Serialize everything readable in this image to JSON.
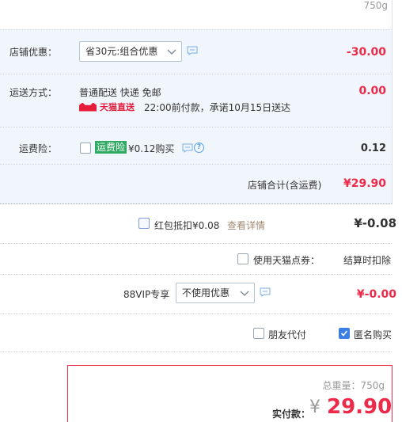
{
  "top": {
    "weight": "750g"
  },
  "shop": {
    "discount": {
      "label": "店铺优惠：",
      "select_value": "省30元:组合优惠",
      "amount": "-30.00"
    },
    "shipping": {
      "label": "运送方式：",
      "methods": "普通配送 快递 免邮",
      "badge": "天猫直送",
      "promise": "22:00前付款，承诺10月15日送达",
      "amount": "0.00"
    },
    "insurance": {
      "label": "运费险：",
      "tag": "运费险",
      "price_text": "¥0.12购买",
      "amount": "0.12"
    },
    "total": {
      "label": "店铺合计(含运费)",
      "amount": "¥29.90"
    }
  },
  "redpacket": {
    "label": "红包抵扣¥0.08",
    "link": "查看详情",
    "amount": "¥-0.08"
  },
  "points": {
    "label": "使用天猫点券：",
    "note": "结算时扣除"
  },
  "vip": {
    "label": "88VIP专享",
    "select_value": "不使用优惠",
    "amount": "¥-0.00"
  },
  "options": {
    "friend_pay": "朋友代付",
    "anonymous": "匿名购买"
  },
  "pay": {
    "weight": "总重量：750g",
    "label": "实付款：",
    "yen": "¥",
    "total": "29.90"
  },
  "colors": {
    "accent_red": "#ee2a4a",
    "blue": "#3b7fe4",
    "green": "#2faa63"
  }
}
